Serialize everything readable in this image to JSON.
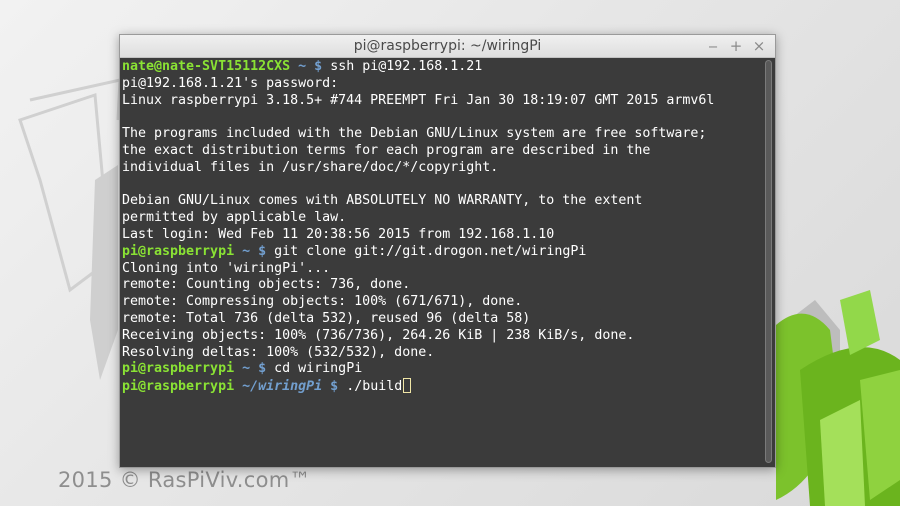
{
  "window": {
    "title": "pi@raspberrypi: ~/wiringPi",
    "buttons": {
      "minimize": "‒",
      "maximize": "+",
      "close": "×"
    }
  },
  "watermark": "2015 © RasPiViv.com™",
  "terminal": {
    "lines": [
      {
        "user": "nate@nate-SVT15112CXS",
        "path": "~",
        "cmd": "ssh pi@192.168.1.21"
      },
      {
        "text": "pi@192.168.1.21's password:"
      },
      {
        "text": "Linux raspberrypi 3.18.5+ #744 PREEMPT Fri Jan 30 18:19:07 GMT 2015 armv6l"
      },
      {
        "text": ""
      },
      {
        "text": "The programs included with the Debian GNU/Linux system are free software;"
      },
      {
        "text": "the exact distribution terms for each program are described in the"
      },
      {
        "text": "individual files in /usr/share/doc/*/copyright."
      },
      {
        "text": ""
      },
      {
        "text": "Debian GNU/Linux comes with ABSOLUTELY NO WARRANTY, to the extent"
      },
      {
        "text": "permitted by applicable law."
      },
      {
        "text": "Last login: Wed Feb 11 20:38:56 2015 from 192.168.1.10"
      },
      {
        "user": "pi@raspberrypi",
        "path": "~",
        "cmd": "git clone git://git.drogon.net/wiringPi"
      },
      {
        "text": "Cloning into 'wiringPi'..."
      },
      {
        "text": "remote: Counting objects: 736, done."
      },
      {
        "text": "remote: Compressing objects: 100% (671/671), done."
      },
      {
        "text": "remote: Total 736 (delta 532), reused 96 (delta 58)"
      },
      {
        "text": "Receiving objects: 100% (736/736), 264.26 KiB | 238 KiB/s, done."
      },
      {
        "text": "Resolving deltas: 100% (532/532), done."
      },
      {
        "user": "pi@raspberrypi",
        "path": "~",
        "cmd": "cd wiringPi"
      },
      {
        "user": "pi@raspberrypi",
        "path": "~/wiringPi",
        "cmd": "./build",
        "cursor": true
      }
    ]
  },
  "colors": {
    "prompt_user": "#8ae234",
    "prompt_path": "#729fcf",
    "terminal_bg": "#3b3b3b",
    "terminal_fg": "#ffffff"
  }
}
